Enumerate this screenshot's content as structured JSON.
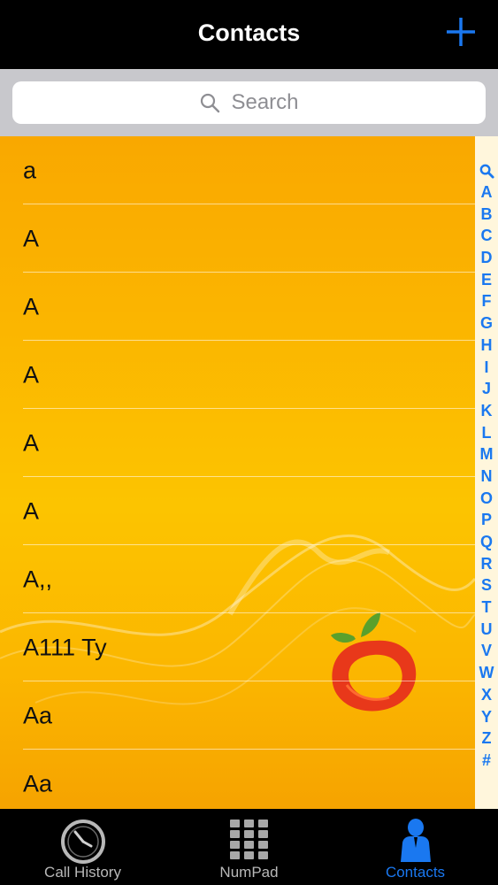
{
  "header": {
    "title": "Contacts",
    "add_icon": "plus-icon"
  },
  "search": {
    "placeholder": "Search",
    "icon": "search-icon"
  },
  "contacts": [
    {
      "name": "a"
    },
    {
      "name": "A"
    },
    {
      "name": "A"
    },
    {
      "name": "A"
    },
    {
      "name": "A"
    },
    {
      "name": "A"
    },
    {
      "name": "A,,"
    },
    {
      "name": "A111 Ty"
    },
    {
      "name": "Aa"
    },
    {
      "name": "Aa"
    }
  ],
  "index_letters": [
    "A",
    "B",
    "C",
    "D",
    "E",
    "F",
    "G",
    "H",
    "I",
    "J",
    "K",
    "L",
    "M",
    "N",
    "O",
    "P",
    "Q",
    "R",
    "S",
    "T",
    "U",
    "V",
    "W",
    "X",
    "Y",
    "Z",
    "#"
  ],
  "tabs": [
    {
      "label": "Call History",
      "icon": "clock-icon",
      "active": false
    },
    {
      "label": "NumPad",
      "icon": "keypad-icon",
      "active": false
    },
    {
      "label": "Contacts",
      "icon": "person-icon",
      "active": true
    }
  ],
  "colors": {
    "accent": "#1a78f0",
    "background": "#fbb400",
    "nav": "#000000"
  }
}
